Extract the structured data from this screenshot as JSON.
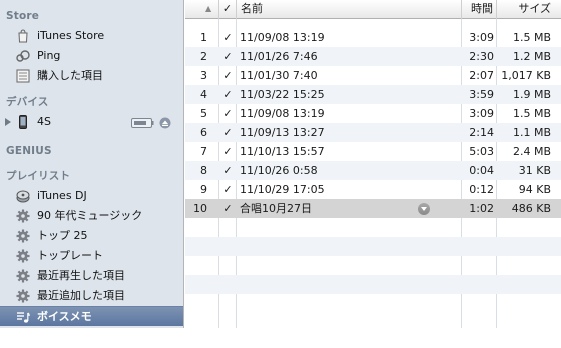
{
  "sidebar": {
    "sections": {
      "store": "Store",
      "devices": "デバイス",
      "genius": "GENIUS",
      "playlists": "プレイリスト"
    },
    "store_items": [
      {
        "label": "iTunes Store",
        "icon": "itunes-store-icon"
      },
      {
        "label": "Ping",
        "icon": "ping-icon"
      },
      {
        "label": "購入した項目",
        "icon": "purchased-icon"
      }
    ],
    "device": {
      "label": "4S",
      "icon": "iphone-icon"
    },
    "playlist_items": [
      {
        "label": "iTunes DJ",
        "icon": "itunes-dj-icon"
      },
      {
        "label": "90 年代ミュージック",
        "icon": "smart-playlist-gear-icon"
      },
      {
        "label": "トップ 25",
        "icon": "smart-playlist-gear-icon"
      },
      {
        "label": "トップレート",
        "icon": "smart-playlist-gear-icon"
      },
      {
        "label": "最近再生した項目",
        "icon": "smart-playlist-gear-icon"
      },
      {
        "label": "最近追加した項目",
        "icon": "smart-playlist-gear-icon"
      },
      {
        "label": "ボイスメモ",
        "icon": "voice-memo-playlist-icon",
        "selected": true
      }
    ]
  },
  "table": {
    "headers": {
      "check": "✓",
      "name": "名前",
      "time": "時間",
      "size": "サイズ",
      "sort_indicator": "▲"
    },
    "rows": [
      {
        "num": "1",
        "checked": "✓",
        "name": "11/09/08 13:19",
        "time": "3:09",
        "size": "1.5 MB"
      },
      {
        "num": "2",
        "checked": "✓",
        "name": "11/01/26 7:46",
        "time": "2:30",
        "size": "1.2 MB"
      },
      {
        "num": "3",
        "checked": "✓",
        "name": "11/01/30 7:40",
        "time": "2:07",
        "size": "1,017 KB"
      },
      {
        "num": "4",
        "checked": "✓",
        "name": "11/03/22 15:25",
        "time": "3:59",
        "size": "1.9 MB"
      },
      {
        "num": "5",
        "checked": "✓",
        "name": "11/09/08 13:19",
        "time": "3:09",
        "size": "1.5 MB"
      },
      {
        "num": "6",
        "checked": "✓",
        "name": "11/09/13 13:27",
        "time": "2:14",
        "size": "1.1 MB"
      },
      {
        "num": "7",
        "checked": "✓",
        "name": "11/10/13 15:57",
        "time": "5:03",
        "size": "2.4 MB"
      },
      {
        "num": "8",
        "checked": "✓",
        "name": "11/10/26 0:58",
        "time": "0:04",
        "size": "31 KB"
      },
      {
        "num": "9",
        "checked": "✓",
        "name": "11/10/29 17:05",
        "time": "0:12",
        "size": "94 KB"
      },
      {
        "num": "10",
        "checked": "✓",
        "name": "合唱10月27日",
        "time": "1:02",
        "size": "486 KB",
        "selected": true
      }
    ]
  },
  "colors": {
    "sidebar_bg": "#dde4ec",
    "selection": "#5c76a0",
    "alt_row": "#f0f4f8"
  }
}
